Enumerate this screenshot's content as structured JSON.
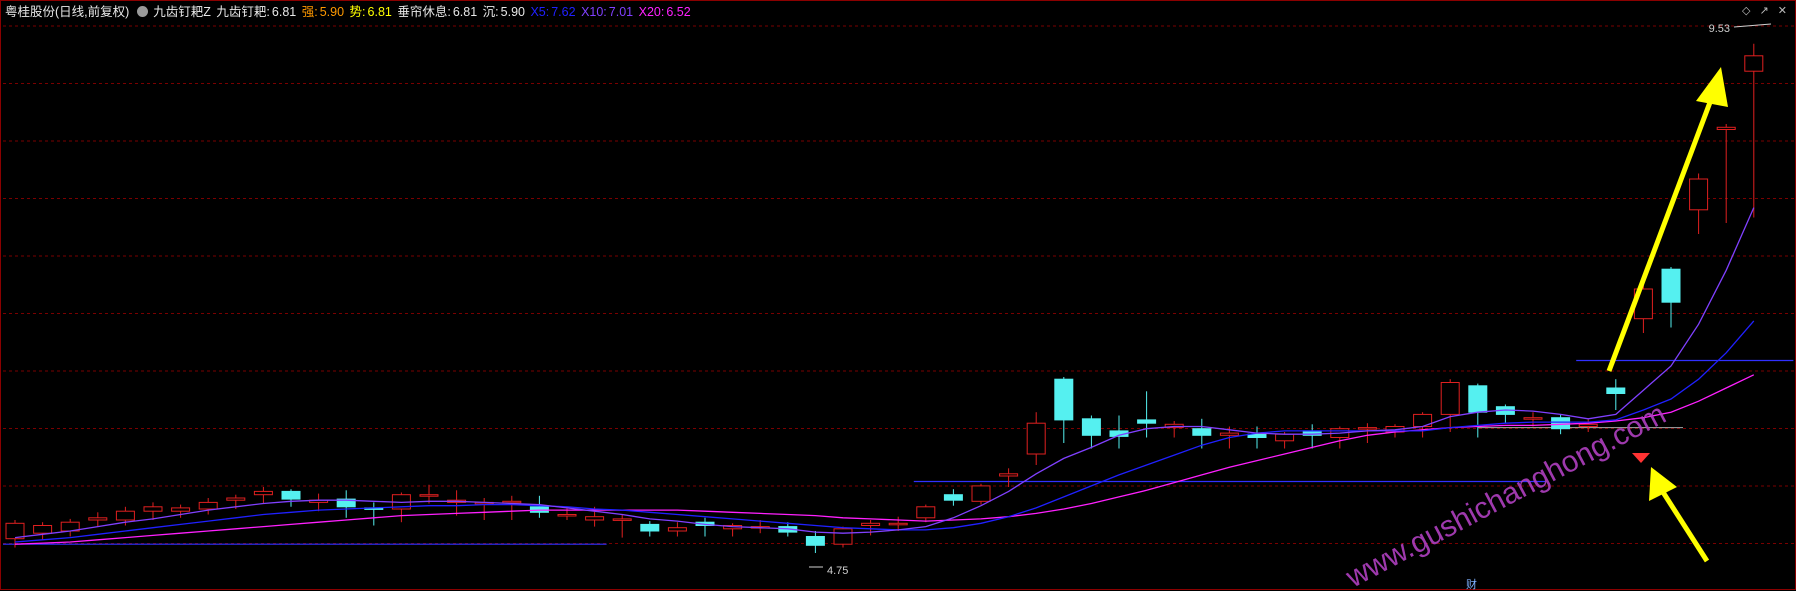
{
  "header": {
    "stock": "粤桂股份(日线,前复权)",
    "indicator": "九齿钉耙Z",
    "l1": "九齿钉耙:",
    "v1": "6.81",
    "l2": "强:",
    "v2": "5.90",
    "l3": "势:",
    "v3": "6.81",
    "l4": "垂帘休息:",
    "v4": "6.81",
    "l5": "沉:",
    "v5": "5.90",
    "l6": "X5:",
    "v6": "7.62",
    "l7": "X10:",
    "v7": "7.01",
    "l8": "X20:",
    "v8": "6.52"
  },
  "colors": {
    "bg": "#000000",
    "grid": "#7a0000",
    "up": "#e02020",
    "down": "#55f0f0",
    "ma5": "#8040ff",
    "ma10": "#2020ff",
    "ma20": "#ff20ff",
    "level": "#3030ff",
    "arrow": "#ffff00",
    "watermark": "#b040c0"
  },
  "labels": {
    "high": "9.53",
    "low": "4.75",
    "fin": "财"
  },
  "watermark": "www.gushichanghong.com",
  "icons": [
    "diamond-icon",
    "arrow-icon",
    "close-icon"
  ],
  "chart_data": {
    "type": "candlestick",
    "y_range": [
      4.6,
      9.7
    ],
    "grid": true,
    "series_names": [
      "X5",
      "X10",
      "X20"
    ],
    "candles": [
      {
        "o": 5.03,
        "c": 5.17,
        "h": 5.2,
        "l": 4.95
      },
      {
        "o": 5.08,
        "c": 5.15,
        "h": 5.18,
        "l": 5.02
      },
      {
        "o": 5.1,
        "c": 5.18,
        "h": 5.21,
        "l": 5.05
      },
      {
        "o": 5.2,
        "c": 5.22,
        "h": 5.27,
        "l": 5.14
      },
      {
        "o": 5.2,
        "c": 5.28,
        "h": 5.32,
        "l": 5.15
      },
      {
        "o": 5.28,
        "c": 5.32,
        "h": 5.36,
        "l": 5.2
      },
      {
        "o": 5.28,
        "c": 5.31,
        "h": 5.34,
        "l": 5.22
      },
      {
        "o": 5.3,
        "c": 5.36,
        "h": 5.4,
        "l": 5.25
      },
      {
        "o": 5.38,
        "c": 5.4,
        "h": 5.43,
        "l": 5.3
      },
      {
        "o": 5.43,
        "c": 5.46,
        "h": 5.5,
        "l": 5.35
      },
      {
        "o": 5.46,
        "c": 5.39,
        "h": 5.48,
        "l": 5.32
      },
      {
        "o": 5.36,
        "c": 5.38,
        "h": 5.44,
        "l": 5.28
      },
      {
        "o": 5.39,
        "c": 5.32,
        "h": 5.47,
        "l": 5.22
      },
      {
        "o": 5.31,
        "c": 5.3,
        "h": 5.36,
        "l": 5.15
      },
      {
        "o": 5.3,
        "c": 5.43,
        "h": 5.45,
        "l": 5.18
      },
      {
        "o": 5.43,
        "c": 5.43,
        "h": 5.52,
        "l": 5.35
      },
      {
        "o": 5.36,
        "c": 5.38,
        "h": 5.47,
        "l": 5.24
      },
      {
        "o": 5.36,
        "c": 5.36,
        "h": 5.4,
        "l": 5.2
      },
      {
        "o": 5.37,
        "c": 5.37,
        "h": 5.42,
        "l": 5.2
      },
      {
        "o": 5.32,
        "c": 5.27,
        "h": 5.42,
        "l": 5.22
      },
      {
        "o": 5.25,
        "c": 5.25,
        "h": 5.32,
        "l": 5.2
      },
      {
        "o": 5.2,
        "c": 5.23,
        "h": 5.32,
        "l": 5.14
      },
      {
        "o": 5.21,
        "c": 5.21,
        "h": 5.25,
        "l": 5.04
      },
      {
        "o": 5.16,
        "c": 5.1,
        "h": 5.19,
        "l": 5.05
      },
      {
        "o": 5.1,
        "c": 5.13,
        "h": 5.18,
        "l": 5.05
      },
      {
        "o": 5.18,
        "c": 5.15,
        "h": 5.22,
        "l": 5.05
      },
      {
        "o": 5.12,
        "c": 5.15,
        "h": 5.17,
        "l": 5.05
      },
      {
        "o": 5.14,
        "c": 5.14,
        "h": 5.2,
        "l": 5.08
      },
      {
        "o": 5.14,
        "c": 5.09,
        "h": 5.18,
        "l": 5.05
      },
      {
        "o": 5.05,
        "c": 4.97,
        "h": 5.1,
        "l": 4.9
      },
      {
        "o": 4.98,
        "c": 5.12,
        "h": 5.14,
        "l": 4.95
      },
      {
        "o": 5.15,
        "c": 5.17,
        "h": 5.2,
        "l": 5.06
      },
      {
        "o": 5.17,
        "c": 5.17,
        "h": 5.23,
        "l": 5.1
      },
      {
        "o": 5.22,
        "c": 5.32,
        "h": 5.34,
        "l": 5.18
      },
      {
        "o": 5.43,
        "c": 5.38,
        "h": 5.48,
        "l": 5.33
      },
      {
        "o": 5.37,
        "c": 5.51,
        "h": 5.53,
        "l": 5.34
      },
      {
        "o": 5.6,
        "c": 5.62,
        "h": 5.67,
        "l": 5.5
      },
      {
        "o": 5.8,
        "c": 6.08,
        "h": 6.18,
        "l": 5.7
      },
      {
        "o": 6.48,
        "c": 6.11,
        "h": 6.5,
        "l": 5.9
      },
      {
        "o": 6.12,
        "c": 5.97,
        "h": 6.15,
        "l": 5.85
      },
      {
        "o": 6.01,
        "c": 5.96,
        "h": 6.15,
        "l": 5.85
      },
      {
        "o": 6.11,
        "c": 6.08,
        "h": 6.37,
        "l": 5.95
      },
      {
        "o": 6.04,
        "c": 6.07,
        "h": 6.1,
        "l": 5.95
      },
      {
        "o": 6.03,
        "c": 5.97,
        "h": 6.12,
        "l": 5.85
      },
      {
        "o": 5.97,
        "c": 5.99,
        "h": 6.05,
        "l": 5.85
      },
      {
        "o": 5.98,
        "c": 5.95,
        "h": 6.05,
        "l": 5.85
      },
      {
        "o": 5.92,
        "c": 5.98,
        "h": 6.0,
        "l": 5.85
      },
      {
        "o": 6.01,
        "c": 5.97,
        "h": 6.07,
        "l": 5.85
      },
      {
        "o": 5.95,
        "c": 6.03,
        "h": 6.05,
        "l": 5.85
      },
      {
        "o": 6.03,
        "c": 6.04,
        "h": 6.08,
        "l": 5.9
      },
      {
        "o": 6.0,
        "c": 6.05,
        "h": 6.07,
        "l": 5.95
      },
      {
        "o": 6.05,
        "c": 6.16,
        "h": 6.18,
        "l": 5.95
      },
      {
        "o": 6.16,
        "c": 6.45,
        "h": 6.48,
        "l": 6.0
      },
      {
        "o": 6.42,
        "c": 6.18,
        "h": 6.44,
        "l": 5.95
      },
      {
        "o": 6.23,
        "c": 6.16,
        "h": 6.25,
        "l": 6.08
      },
      {
        "o": 6.12,
        "c": 6.13,
        "h": 6.18,
        "l": 6.05
      },
      {
        "o": 6.13,
        "c": 6.03,
        "h": 6.16,
        "l": 5.98
      },
      {
        "o": 6.05,
        "c": 6.07,
        "h": 6.12,
        "l": 6.0
      },
      {
        "o": 6.4,
        "c": 6.35,
        "h": 6.48,
        "l": 6.2
      },
      {
        "o": 7.03,
        "c": 7.3,
        "h": 7.35,
        "l": 6.9
      },
      {
        "o": 7.48,
        "c": 7.18,
        "h": 7.5,
        "l": 6.95
      },
      {
        "o": 8.02,
        "c": 8.3,
        "h": 8.35,
        "l": 7.8
      },
      {
        "o": 8.75,
        "c": 8.77,
        "h": 8.8,
        "l": 7.9
      },
      {
        "o": 9.28,
        "c": 9.42,
        "h": 9.53,
        "l": 7.95
      }
    ],
    "ma5": [
      5.04,
      5.07,
      5.1,
      5.14,
      5.18,
      5.21,
      5.25,
      5.29,
      5.32,
      5.35,
      5.37,
      5.38,
      5.38,
      5.37,
      5.36,
      5.37,
      5.37,
      5.36,
      5.35,
      5.34,
      5.31,
      5.28,
      5.25,
      5.21,
      5.19,
      5.16,
      5.14,
      5.13,
      5.12,
      5.09,
      5.08,
      5.09,
      5.11,
      5.14,
      5.22,
      5.33,
      5.46,
      5.62,
      5.76,
      5.86,
      5.97,
      6.03,
      6.05,
      6.05,
      6.02,
      5.99,
      5.98,
      5.98,
      5.99,
      6.01,
      6.02,
      6.05,
      6.14,
      6.18,
      6.2,
      6.19,
      6.16,
      6.12,
      6.16,
      6.38,
      6.6,
      6.98,
      7.47,
      8.04
    ],
    "ma10": [
      5.0,
      5.02,
      5.04,
      5.07,
      5.1,
      5.13,
      5.16,
      5.19,
      5.22,
      5.25,
      5.27,
      5.29,
      5.3,
      5.31,
      5.32,
      5.33,
      5.33,
      5.34,
      5.34,
      5.33,
      5.32,
      5.3,
      5.29,
      5.27,
      5.25,
      5.23,
      5.21,
      5.19,
      5.17,
      5.15,
      5.13,
      5.12,
      5.11,
      5.11,
      5.13,
      5.17,
      5.23,
      5.31,
      5.41,
      5.51,
      5.61,
      5.7,
      5.79,
      5.88,
      5.95,
      5.99,
      6.01,
      6.01,
      6.01,
      6.01,
      6.01,
      6.01,
      6.04,
      6.06,
      6.08,
      6.09,
      6.09,
      6.09,
      6.11,
      6.2,
      6.3,
      6.48,
      6.72,
      7.01
    ],
    "ma20": [
      4.98,
      4.99,
      5.0,
      5.02,
      5.04,
      5.06,
      5.08,
      5.1,
      5.12,
      5.14,
      5.16,
      5.18,
      5.2,
      5.22,
      5.24,
      5.25,
      5.26,
      5.27,
      5.28,
      5.29,
      5.29,
      5.29,
      5.29,
      5.29,
      5.29,
      5.28,
      5.27,
      5.26,
      5.25,
      5.24,
      5.22,
      5.21,
      5.2,
      5.19,
      5.2,
      5.21,
      5.23,
      5.26,
      5.3,
      5.35,
      5.41,
      5.47,
      5.54,
      5.61,
      5.68,
      5.74,
      5.8,
      5.86,
      5.92,
      5.97,
      6.0,
      6.02,
      6.04,
      6.05,
      6.06,
      6.06,
      6.07,
      6.08,
      6.1,
      6.13,
      6.18,
      6.28,
      6.4,
      6.52
    ],
    "level_lines": [
      {
        "y": 4.98,
        "from": 0,
        "to": 21
      },
      {
        "y": 5.55,
        "from": 33,
        "to": 55
      },
      {
        "y": 6.65,
        "from": 57,
        "to": 64
      }
    ],
    "ref_line": {
      "y": 6.04,
      "from": 53,
      "to": 60
    }
  }
}
